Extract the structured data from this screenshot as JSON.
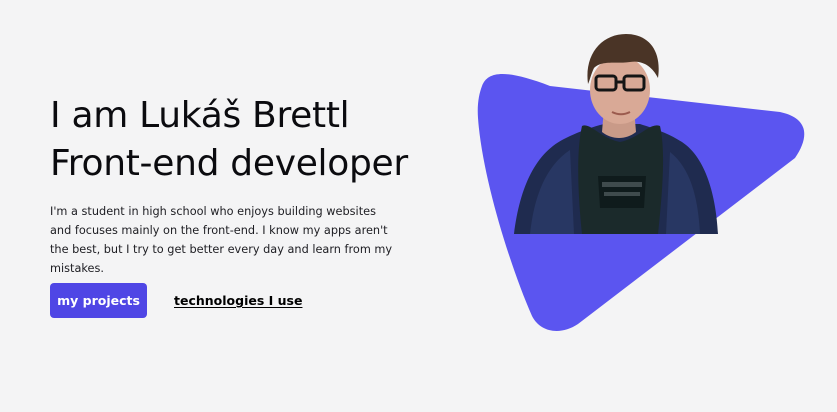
{
  "hero": {
    "headline_line1": "I am Lukáš Brettl",
    "headline_line2": "Front-end developer",
    "description": "I'm a student in high school who enjoys building websites and focuses mainly on the front-end. I know my apps aren't the best, but I try to get better every day and learn from my mistakes.",
    "primary_button_label": "my projects",
    "secondary_link_label": "technologies I use"
  },
  "colors": {
    "accent": "#5b55f0",
    "button": "#4f46e5",
    "background": "#f4f4f5"
  },
  "portrait": {
    "overlay_icon": "portrait-photo"
  }
}
